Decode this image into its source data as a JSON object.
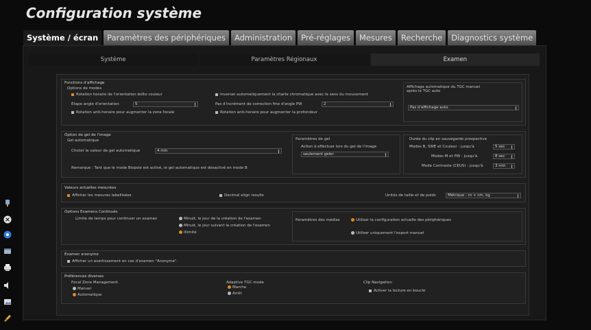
{
  "title": "Configuration système",
  "main_tabs": [
    "Système / écran",
    "Paramètres des périphériques",
    "Administration",
    "Pré-réglages",
    "Mesures",
    "Recherche",
    "Diagnostics système"
  ],
  "sub_tabs": [
    "Système",
    "Paramètres Régionaux",
    "Examen"
  ],
  "display": {
    "section": "Fonctions d'affichage",
    "modes": "Options de modes",
    "rot_color": "Rotation horaire de l'orientation boîte couleur",
    "step_label": "Étape angle d'orientation",
    "step_value": "5",
    "rot_focal": "Rotation anti-horaire pour augmenter la zone focale",
    "invert_map": "Inverser automatiquement la charte chromatique avec le sens du mouvement",
    "pw_label": "Pas d'incrément de correction fine d'angle PW",
    "pw_value": "2",
    "rot_depth": "Rotation anti-horaire pour augmenter la profondeur",
    "tgc_label1": "Affichage automatique du TGC manuel",
    "tgc_label2": "après le TGC auto",
    "tgc_value": "Pas d'affichage auto"
  },
  "freeze": {
    "section": "Option de gel de l'image",
    "auto": "Gel automatique",
    "choose": "Choisir la valeur de gel automatique",
    "choose_value": "4 min",
    "note": "Remarque : Tant que le mode Biopsie est activé, le gel automatique est désactivé en mode B",
    "params": "Paramètres de gel",
    "action": "Action à effectuer lors du gel de l'image",
    "action_value": "seulement geler",
    "clip": "Durée du clip en sauvegarde prospective",
    "clip_b": "Modes B, SWE et Couleur : jusqu'à",
    "clip_b_value": "5 sec",
    "clip_m": "Modes M et PW : jusqu'à",
    "clip_m_value": "8 sec",
    "clip_c": "Mode Contraste (CEUS) : jusqu'à",
    "clip_c_value": "3 min"
  },
  "measures": {
    "section": "Valeurs actuelles mesurées",
    "labelled": "Afficher les mesures labellisées",
    "decimal": "Decimal align results",
    "units": "Unités de taille et de poids",
    "units_value": "Métrique : m + cm, kg"
  },
  "continued": {
    "section": "Options Examens Continués",
    "limit": "Limite de temps pour continuer un examen",
    "opt1": "Minuit, le jour de la création de l'examen",
    "opt2": "Minuit, le jour suivant la création de l'examen",
    "opt3": "Illimité",
    "media": "Paramètres des médias",
    "media1": "Utiliser la configuration actuelle des périphériques",
    "media2": "Utiliser uniquement l'export manuel"
  },
  "anon": {
    "section": "Examen anonyme",
    "warn": "Afficher un avertissement en cas d'examen \"Anonyme\"."
  },
  "prefs": {
    "section": "Préférences diverses",
    "focal": "Focal Zone Management",
    "focal1": "Manuel",
    "focal2": "Automatique",
    "tgc": "Adaptive TGC mode",
    "tgc1": "Marche",
    "tgc2": "Arrêt",
    "clipnav": "Clip Navigation",
    "clipnav1": "Activer la lecture en boucle"
  },
  "accent": "#e08a1e"
}
